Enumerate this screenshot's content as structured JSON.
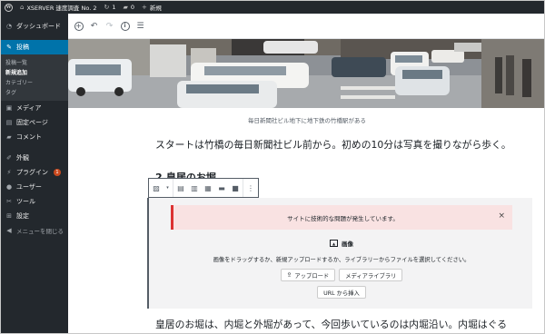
{
  "admin_bar": {
    "site_title": "XSERVER 速度調査 No. 2",
    "updates_count": "1",
    "comments_count": "0",
    "new_label": "新規"
  },
  "sidebar": {
    "dashboard": "ダッシュボード",
    "posts": "投稿",
    "posts_sub": [
      "投稿一覧",
      "新規追加",
      "カテゴリー",
      "タグ"
    ],
    "media": "メディア",
    "pages": "固定ページ",
    "comments": "コメント",
    "appearance": "外観",
    "plugins": "プラグイン",
    "plugins_badge": "1",
    "users": "ユーザー",
    "tools": "ツール",
    "settings": "設定",
    "collapse": "メニューを閉じる"
  },
  "content": {
    "caption": "毎日新聞社ビル地下に地下鉄の竹橋駅がある",
    "paragraph1": "スタートは竹橋の毎日新聞社ビル前から。初めの10分は写真を撮りながら歩く。",
    "heading": "2.皇居のお堀",
    "paragraph2": "皇居のお堀は、内堀と外堀があって、今回歩いているのは内堀沿い。内堀はぐる"
  },
  "image_block": {
    "notice": "サイトに技術的な問題が発生しています。",
    "notice_close": "×",
    "label": "画像",
    "instructions": "画像をドラッグするか、新規アップロードするか、ライブラリーからファイルを選択してください。",
    "upload_button": "アップロード",
    "media_library_button": "メディアライブラリ",
    "insert_url_button": "URL から挿入"
  },
  "colors": {
    "admin_dark": "#23282d",
    "active_blue": "#0073aa",
    "notice_red": "#dc3232",
    "notice_bg": "#f9e2e2"
  }
}
